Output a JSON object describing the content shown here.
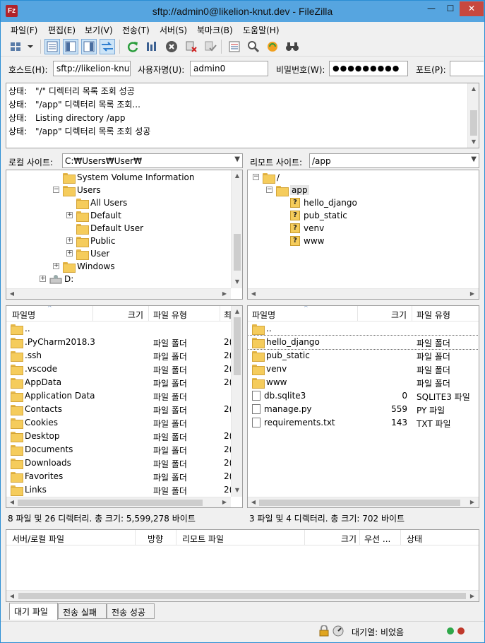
{
  "window": {
    "title": "sftp://admin0@likelion-knut.dev - FileZilla",
    "app_icon_text": "Fz",
    "min_label": "—",
    "max_label": "☐",
    "close_label": "✕"
  },
  "menu": [
    {
      "label": "파일(F)"
    },
    {
      "label": "편집(E)"
    },
    {
      "label": "보기(V)"
    },
    {
      "label": "전송(T)"
    },
    {
      "label": "서버(S)"
    },
    {
      "label": "북마크(B)"
    },
    {
      "label": "도움말(H)"
    }
  ],
  "quickconnect": {
    "host_label": "호스트(H):",
    "host_value": "sftp://likelion-knut",
    "user_label": "사용자명(U):",
    "user_value": "admin0",
    "pass_label": "비밀번호(W):",
    "pass_value": "●●●●●●●●●",
    "port_label": "포트(P):",
    "port_value": ""
  },
  "log": [
    {
      "key": "상태:",
      "msg": "\"/\" 디렉터리 목록 조회 성공"
    },
    {
      "key": "상태:",
      "msg": "\"/app\" 디렉터리 목록 조회..."
    },
    {
      "key": "상태:",
      "msg": "Listing directory /app"
    },
    {
      "key": "상태:",
      "msg": "\"/app\" 디렉터리 목록 조회 성공"
    }
  ],
  "local": {
    "site_label": "로컬 사이트:",
    "path": "C:₩Users₩User₩",
    "tree": [
      {
        "label": "System Volume Information",
        "expander": ""
      },
      {
        "label": "Users",
        "expander": "−"
      },
      {
        "label": "All Users",
        "expander": ""
      },
      {
        "label": "Default",
        "expander": "+"
      },
      {
        "label": "Default User",
        "expander": ""
      },
      {
        "label": "Public",
        "expander": "+"
      },
      {
        "label": "User",
        "expander": "+"
      },
      {
        "label": "Windows",
        "expander": "+"
      },
      {
        "label": "D:",
        "expander": "+"
      }
    ],
    "columns": {
      "name": "파일명",
      "size": "크기",
      "type": "파일 유형",
      "date": "최"
    },
    "files": [
      {
        "name": "..",
        "size": "",
        "type": "",
        "date": ""
      },
      {
        "name": ".PyCharm2018.3",
        "size": "",
        "type": "파일 폴더",
        "date": "2("
      },
      {
        "name": ".ssh",
        "size": "",
        "type": "파일 폴더",
        "date": "2("
      },
      {
        "name": ".vscode",
        "size": "",
        "type": "파일 폴더",
        "date": "2("
      },
      {
        "name": "AppData",
        "size": "",
        "type": "파일 폴더",
        "date": "2("
      },
      {
        "name": "Application Data",
        "size": "",
        "type": "파일 폴더",
        "date": ""
      },
      {
        "name": "Contacts",
        "size": "",
        "type": "파일 폴더",
        "date": "2("
      },
      {
        "name": "Cookies",
        "size": "",
        "type": "파일 폴더",
        "date": ""
      },
      {
        "name": "Desktop",
        "size": "",
        "type": "파일 폴더",
        "date": "2("
      },
      {
        "name": "Documents",
        "size": "",
        "type": "파일 폴더",
        "date": "2("
      },
      {
        "name": "Downloads",
        "size": "",
        "type": "파일 폴더",
        "date": "2("
      },
      {
        "name": "Favorites",
        "size": "",
        "type": "파일 폴더",
        "date": "2("
      },
      {
        "name": "Links",
        "size": "",
        "type": "파일 폴더",
        "date": "2("
      }
    ],
    "status": "8 파일 및 26 디렉터리. 총 크기: 5,599,278 바이트"
  },
  "remote": {
    "site_label": "리모트 사이트:",
    "path": "/app",
    "tree": [
      {
        "label": "/",
        "expander": "−"
      },
      {
        "label": "app",
        "expander": "−"
      },
      {
        "label": "hello_django",
        "expander": ""
      },
      {
        "label": "pub_static",
        "expander": ""
      },
      {
        "label": "venv",
        "expander": ""
      },
      {
        "label": "www",
        "expander": ""
      }
    ],
    "columns": {
      "name": "파일명",
      "size": "크기",
      "type": "파일 유형"
    },
    "files": [
      {
        "name": "..",
        "size": "",
        "type": ""
      },
      {
        "name": "hello_django",
        "size": "",
        "type": "파일 폴더"
      },
      {
        "name": "pub_static",
        "size": "",
        "type": "파일 폴더"
      },
      {
        "name": "venv",
        "size": "",
        "type": "파일 폴더"
      },
      {
        "name": "www",
        "size": "",
        "type": "파일 폴더"
      },
      {
        "name": "db.sqlite3",
        "size": "0",
        "type": "SQLITE3 파일"
      },
      {
        "name": "manage.py",
        "size": "559",
        "type": "PY 파일"
      },
      {
        "name": "requirements.txt",
        "size": "143",
        "type": "TXT 파일"
      }
    ],
    "status": "3 파일 및 4 디렉터리. 총 크기: 702 바이트"
  },
  "queue": {
    "columns": {
      "server": "서버/로컬 파일",
      "direction": "방향",
      "remote": "리모트 파일",
      "size": "크기",
      "priority": "우선 ...",
      "status": "상태"
    },
    "tabs": [
      {
        "label": "대기 파일"
      },
      {
        "label": "전송 실패"
      },
      {
        "label": "전송 성공"
      }
    ]
  },
  "statusbar": {
    "queue_text": "대기열: 비었음"
  },
  "colors": {
    "titlebar": "#56a5e0",
    "close": "#c7483f",
    "folder": "#f5cc5c",
    "led_green": "#2fa84a",
    "led_red": "#c0392b"
  }
}
